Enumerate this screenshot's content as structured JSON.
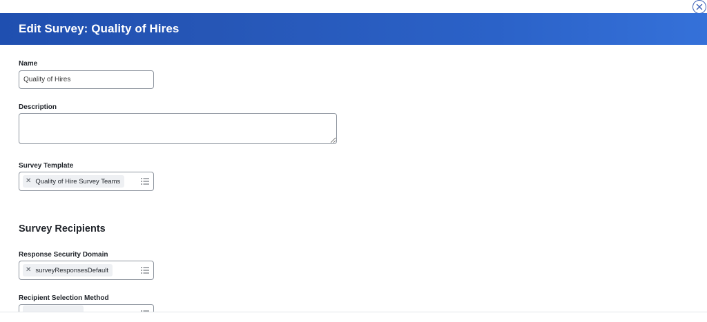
{
  "header": {
    "title": "Edit Survey: Quality of Hires"
  },
  "form": {
    "name": {
      "label": "Name",
      "value": "Quality of Hires"
    },
    "description": {
      "label": "Description",
      "value": ""
    },
    "survey_template": {
      "label": "Survey Template",
      "selected": "Quality of Hire Survey Teams"
    },
    "recipients_section": {
      "title": "Survey Recipients"
    },
    "response_security_domain": {
      "label": "Response Security Domain",
      "selected": "surveyResponsesDefault"
    },
    "recipient_selection_method": {
      "label": "Recipient Selection Method"
    }
  },
  "icons": {
    "close": "close-circle-icon",
    "remove": "x-icon",
    "prompt": "list-icon"
  },
  "colors": {
    "header_start": "#1f4fb0",
    "header_end": "#3571d9",
    "input_border": "#8d949e",
    "pill_bg": "#eef0f3"
  }
}
